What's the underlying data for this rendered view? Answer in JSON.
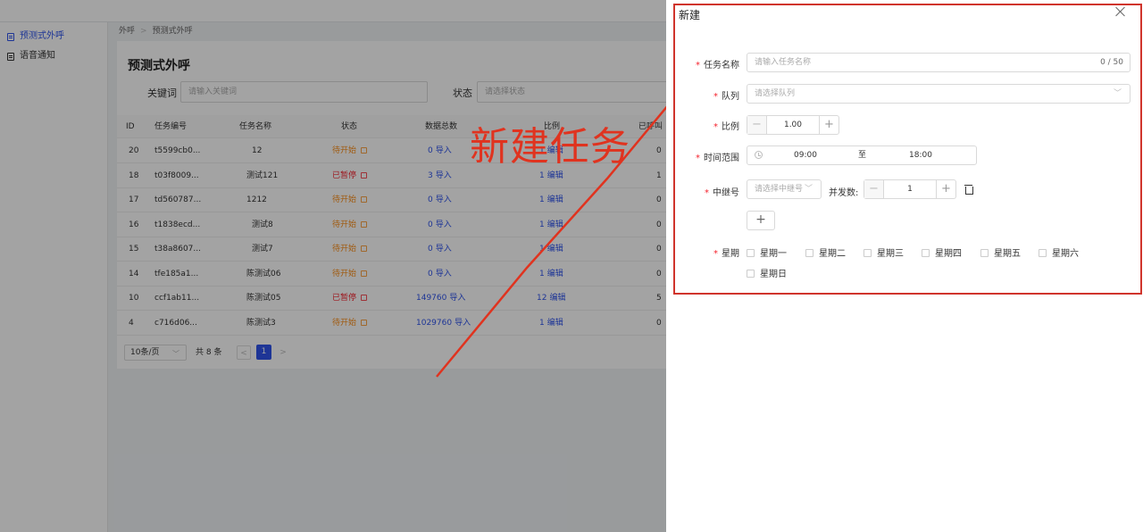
{
  "sidebar": {
    "items": [
      {
        "label": "预测式外呼",
        "active": true
      },
      {
        "label": "语音通知",
        "active": false
      }
    ]
  },
  "breadcrumb": {
    "root": "外呼",
    "sep": ">",
    "current": "预测式外呼"
  },
  "page": {
    "title": "预测式外呼",
    "filters": {
      "keyword_label": "关键词",
      "keyword_placeholder": "请输入关键词",
      "status_label": "状态",
      "status_placeholder": "请选择状态"
    }
  },
  "table": {
    "headers": [
      "ID",
      "任务编号",
      "任务名称",
      "状态",
      "数据总数",
      "比例",
      "已呼叫"
    ],
    "rows": [
      {
        "id": "20",
        "code": "t5599cb0...",
        "name": "12",
        "status": "待开始",
        "total": "0",
        "import": "导入",
        "ratio": "1",
        "edit": "编辑",
        "called": "0"
      },
      {
        "id": "18",
        "code": "t03f8009...",
        "name": "测试121",
        "status": "已暂停",
        "total": "3",
        "import": "导入",
        "ratio": "1",
        "edit": "编辑",
        "called": "1"
      },
      {
        "id": "17",
        "code": "td560787...",
        "name": "1212",
        "status": "待开始",
        "total": "0",
        "import": "导入",
        "ratio": "1",
        "edit": "编辑",
        "called": "0"
      },
      {
        "id": "16",
        "code": "t1838ecd...",
        "name": "测试8",
        "status": "待开始",
        "total": "0",
        "import": "导入",
        "ratio": "1",
        "edit": "编辑",
        "called": "0"
      },
      {
        "id": "15",
        "code": "t38a8607...",
        "name": "测试7",
        "status": "待开始",
        "total": "0",
        "import": "导入",
        "ratio": "1",
        "edit": "编辑",
        "called": "0"
      },
      {
        "id": "14",
        "code": "tfe185a1...",
        "name": "陈测试06",
        "status": "待开始",
        "total": "0",
        "import": "导入",
        "ratio": "1",
        "edit": "编辑",
        "called": "0"
      },
      {
        "id": "10",
        "code": "ccf1ab11...",
        "name": "陈测试05",
        "status": "已暂停",
        "total": "149760",
        "import": "导入",
        "ratio": "12",
        "edit": "编辑",
        "called": "5"
      },
      {
        "id": "4",
        "code": "c716d06...",
        "name": "陈测试3",
        "status": "待开始",
        "total": "1029760",
        "import": "导入",
        "ratio": "1",
        "edit": "编辑",
        "called": "0"
      }
    ]
  },
  "pager": {
    "page_size": "10条/页",
    "total": "共 8 条",
    "prev": "<",
    "current": "1",
    "next": ">"
  },
  "annotation": {
    "text": "新建任务"
  },
  "drawer": {
    "title": "新建",
    "fields": {
      "task_name": {
        "label": "任务名称",
        "placeholder": "请输入任务名称",
        "counter": "0 / 50"
      },
      "queue": {
        "label": "队列",
        "placeholder": "请选择队列"
      },
      "ratio": {
        "label": "比例",
        "value": "1.00"
      },
      "time_range": {
        "label": "时间范围",
        "start": "09:00",
        "sep": "至",
        "end": "18:00"
      },
      "relay": {
        "label": "中继号",
        "placeholder": "请选择中继号",
        "concurrency_label": "并发数:",
        "concurrency_value": "1"
      },
      "weekdays": {
        "label": "星期",
        "options": [
          "星期一",
          "星期二",
          "星期三",
          "星期四",
          "星期五",
          "星期六",
          "星期日"
        ]
      }
    },
    "add_label": "+"
  },
  "colors": {
    "primary": "#2f54eb",
    "warning": "#fa8c16",
    "danger": "#f5222d",
    "annotation": "#e0331f"
  }
}
